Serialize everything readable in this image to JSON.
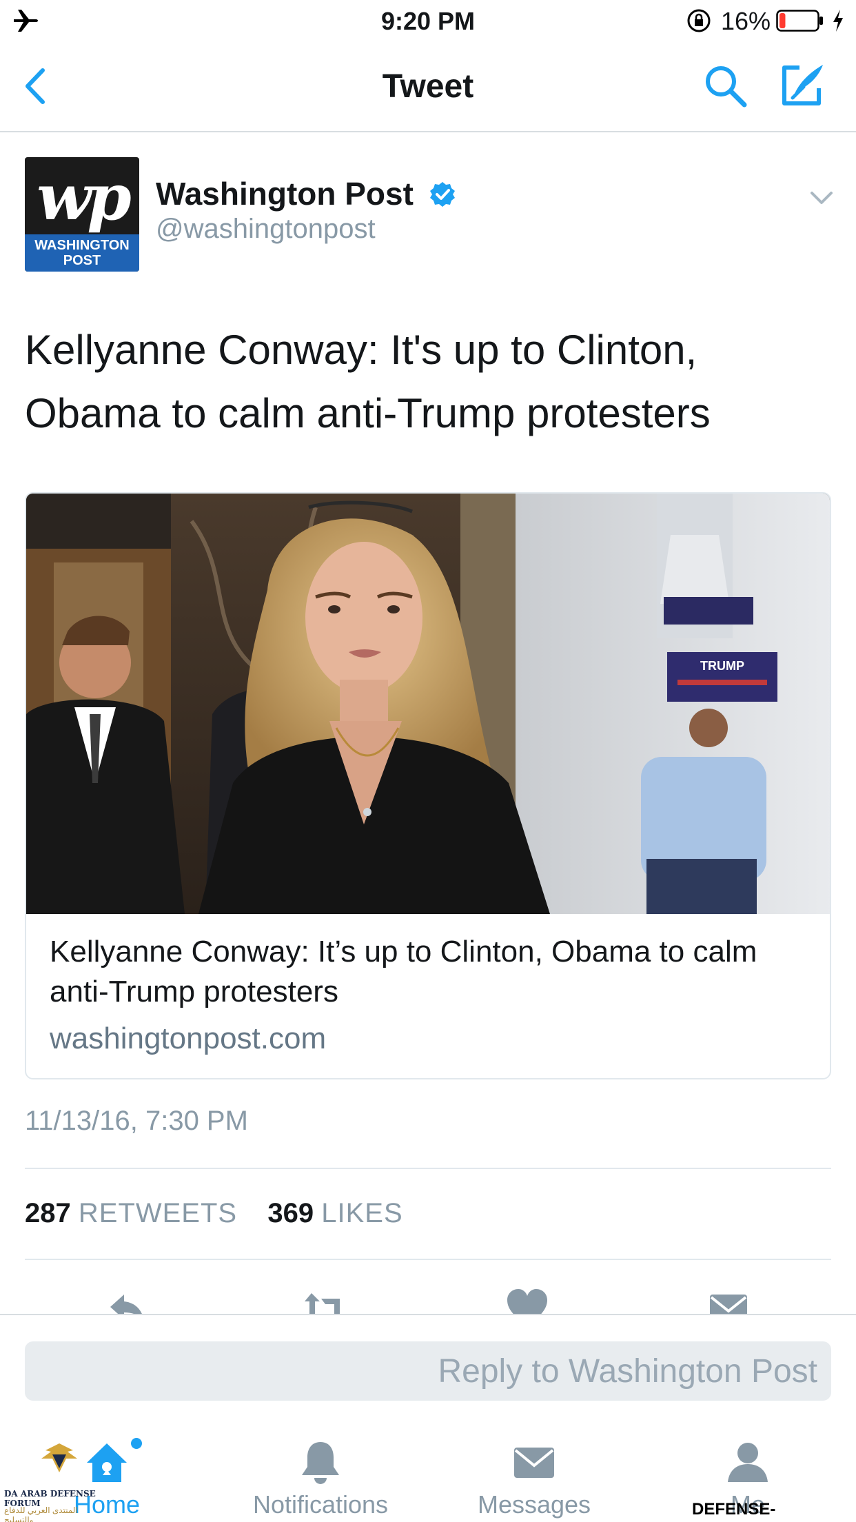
{
  "status_bar": {
    "time": "9:20 PM",
    "battery_percent": "16%",
    "battery_level": 0.16,
    "icons": [
      "airplane-icon",
      "orientation-lock-icon",
      "battery-icon",
      "charging-bolt-icon"
    ]
  },
  "nav": {
    "title": "Tweet",
    "icons": [
      "back-chevron-icon",
      "search-icon",
      "compose-icon"
    ]
  },
  "tweet": {
    "display_name": "Washington Post",
    "handle": "@washingtonpost",
    "avatar_logo": "wp",
    "avatar_band": "WASHINGTON POST",
    "text": "Kellyanne Conway: It's up to Clinton, Obama to calm anti-Trump protesters",
    "timestamp": "11/13/16, 7:30 PM",
    "retweets": "287",
    "retweets_label": "RETWEETS",
    "likes": "369",
    "likes_label": "LIKES",
    "card": {
      "title": "Kellyanne Conway: It’s up to Clinton, Obama to calm anti-Trump protesters",
      "domain": "washingtonpost.com",
      "image_sign": "TRUMP"
    },
    "actions": [
      "reply-icon",
      "retweet-icon",
      "like-icon",
      "direct-message-icon"
    ]
  },
  "reply": {
    "placeholder": "Reply to Washington Post"
  },
  "tabs": [
    {
      "label": "Home",
      "icon": "home-icon",
      "active": true
    },
    {
      "label": "Notifications",
      "icon": "bell-icon",
      "active": false
    },
    {
      "label": "Messages",
      "icon": "envelope-icon",
      "active": false
    },
    {
      "label": "Me",
      "icon": "person-icon",
      "active": false
    }
  ],
  "watermark": {
    "left_text": "ARAB DEFENSE FORUM",
    "left_badge": "DA",
    "left_arabic": "المنتدى العربي للدفاع والتسليح",
    "right_text": "DEFENSE-ARAB.COM"
  },
  "colors": {
    "accent": "#1da1f2",
    "text": "#14171a",
    "muted": "#8899a6",
    "wp_band": "#1f63b4",
    "battery_low": "#ff3b30"
  }
}
